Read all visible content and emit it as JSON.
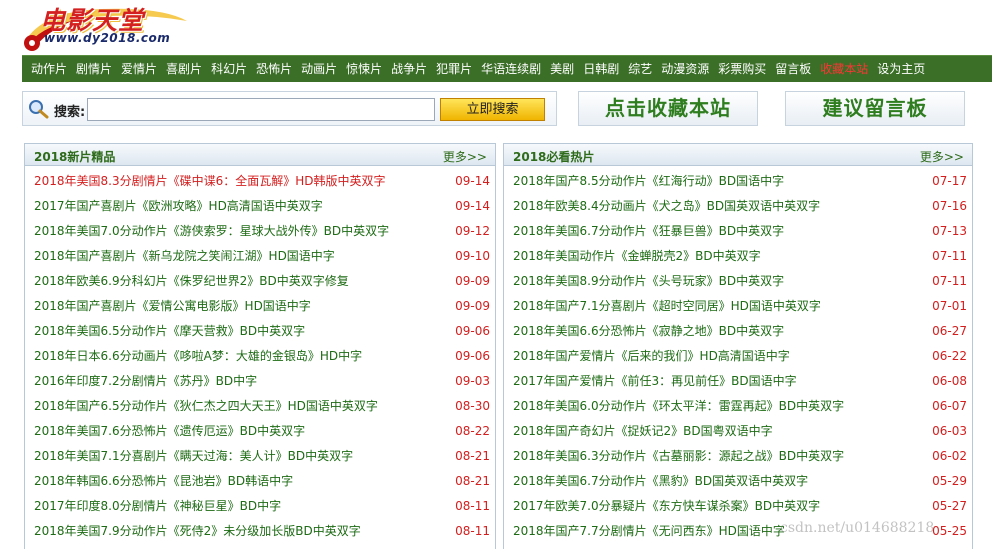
{
  "logo": {
    "title": "电影天堂",
    "url": "www.dy2018.com"
  },
  "nav": {
    "items": [
      {
        "label": "动作片",
        "hot": false
      },
      {
        "label": "剧情片",
        "hot": false
      },
      {
        "label": "爱情片",
        "hot": false
      },
      {
        "label": "喜剧片",
        "hot": false
      },
      {
        "label": "科幻片",
        "hot": false
      },
      {
        "label": "恐怖片",
        "hot": false
      },
      {
        "label": "动画片",
        "hot": false
      },
      {
        "label": "惊悚片",
        "hot": false
      },
      {
        "label": "战争片",
        "hot": false
      },
      {
        "label": "犯罪片",
        "hot": false
      },
      {
        "label": "华语连续剧",
        "hot": false
      },
      {
        "label": "美剧",
        "hot": false
      },
      {
        "label": "日韩剧",
        "hot": false
      },
      {
        "label": "综艺",
        "hot": false
      },
      {
        "label": "动漫资源",
        "hot": false
      },
      {
        "label": "彩票购买",
        "hot": false
      },
      {
        "label": "留言板",
        "hot": false
      },
      {
        "label": "收藏本站",
        "hot": true
      },
      {
        "label": "设为主页",
        "hot": false
      }
    ]
  },
  "search": {
    "label": "搜索:",
    "value": "",
    "placeholder": "",
    "button": "立即搜索"
  },
  "actions": {
    "bookmark": "点击收藏本站",
    "guestbook": "建议留言板"
  },
  "panels": {
    "left": {
      "title": "2018新片精品",
      "more": "更多>>",
      "items": [
        {
          "title": "2018年美国8.3分剧情片《碟中谍6：全面瓦解》HD韩版中英双字",
          "date": "09-14",
          "red": true
        },
        {
          "title": "2017年国产喜剧片《欧洲攻略》HD高清国语中英双字",
          "date": "09-14",
          "red": false
        },
        {
          "title": "2018年美国7.0分动作片《游侠索罗：星球大战外传》BD中英双字",
          "date": "09-12",
          "red": false
        },
        {
          "title": "2018年国产喜剧片《新乌龙院之笑闹江湖》HD国语中字",
          "date": "09-10",
          "red": false
        },
        {
          "title": "2018年欧美6.9分科幻片《侏罗纪世界2》BD中英双字修复",
          "date": "09-09",
          "red": false
        },
        {
          "title": "2018年国产喜剧片《爱情公寓电影版》HD国语中字",
          "date": "09-09",
          "red": false
        },
        {
          "title": "2018年美国6.5分动作片《摩天营救》BD中英双字",
          "date": "09-06",
          "red": false
        },
        {
          "title": "2018年日本6.6分动画片《哆啦A梦：大雄的金银岛》HD中字",
          "date": "09-06",
          "red": false
        },
        {
          "title": "2016年印度7.2分剧情片《苏丹》BD中字",
          "date": "09-03",
          "red": false
        },
        {
          "title": "2018年国产6.5分动作片《狄仁杰之四大天王》HD国语中英双字",
          "date": "08-30",
          "red": false
        },
        {
          "title": "2018年美国7.6分恐怖片《遗传厄运》BD中英双字",
          "date": "08-22",
          "red": false
        },
        {
          "title": "2018年美国7.1分喜剧片《瞒天过海：美人计》BD中英双字",
          "date": "08-21",
          "red": false
        },
        {
          "title": "2018年韩国6.6分恐怖片《昆池岩》BD韩语中字",
          "date": "08-21",
          "red": false
        },
        {
          "title": "2017年印度8.0分剧情片《神秘巨星》BD中字",
          "date": "08-11",
          "red": false
        },
        {
          "title": "2018年美国7.9分动作片《死侍2》未分级加长版BD中英双字",
          "date": "08-11",
          "red": false
        }
      ]
    },
    "right": {
      "title": "2018必看热片",
      "more": "更多>>",
      "items": [
        {
          "title": "2018年国产8.5分动作片《红海行动》BD国语中字",
          "date": "07-17"
        },
        {
          "title": "2018年欧美8.4分动画片《犬之岛》BD国英双语中英双字",
          "date": "07-16"
        },
        {
          "title": "2018年美国6.7分动作片《狂暴巨兽》BD中英双字",
          "date": "07-13"
        },
        {
          "title": "2018年美国动作片《金蝉脱壳2》BD中英双字",
          "date": "07-11"
        },
        {
          "title": "2018年美国8.9分动作片《头号玩家》BD中英双字",
          "date": "07-11"
        },
        {
          "title": "2018年国产7.1分喜剧片《超时空同居》HD国语中英双字",
          "date": "07-01"
        },
        {
          "title": "2018年美国6.6分恐怖片《寂静之地》BD中英双字",
          "date": "06-27"
        },
        {
          "title": "2018年国产爱情片《后来的我们》HD高清国语中字",
          "date": "06-22"
        },
        {
          "title": "2017年国产爱情片《前任3：再见前任》BD国语中字",
          "date": "06-08"
        },
        {
          "title": "2018年美国6.0分动作片《环太平洋：雷霆再起》BD中英双字",
          "date": "06-07"
        },
        {
          "title": "2018年国产奇幻片《捉妖记2》BD国粤双语中字",
          "date": "06-03"
        },
        {
          "title": "2018年美国6.3分动作片《古墓丽影：源起之战》BD中英双字",
          "date": "06-02"
        },
        {
          "title": "2018年美国6.7分动作片《黑豹》BD国英双语中英双字",
          "date": "05-29"
        },
        {
          "title": "2017年欧美7.0分暴疑片《东方快车谋杀案》BD中英双字",
          "date": "05-27"
        },
        {
          "title": "2018年国产7.7分剧情片《无问西东》HD国语中字",
          "date": "05-25"
        }
      ]
    }
  },
  "watermark": "csdn.net/u014688218",
  "colors": {
    "nav_bg": "#3b6f28",
    "link_green": "#1d6b14",
    "date_red": "#d41e1e",
    "button_yellow": "#f0b400"
  }
}
